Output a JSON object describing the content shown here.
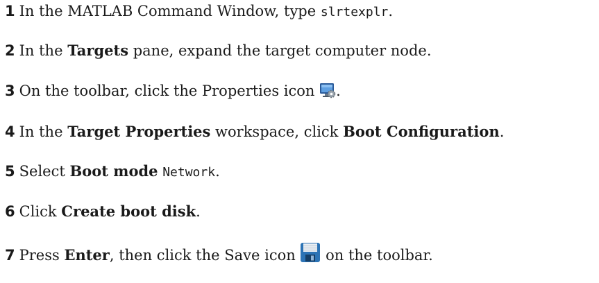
{
  "steps": [
    {
      "number": "1",
      "parts": [
        {
          "t": "text",
          "v": "In the MATLAB Command Window, type "
        },
        {
          "t": "code",
          "v": "slrtexplr"
        },
        {
          "t": "text",
          "v": "."
        }
      ]
    },
    {
      "number": "2",
      "parts": [
        {
          "t": "text",
          "v": "In the "
        },
        {
          "t": "bold",
          "v": "Targets"
        },
        {
          "t": "text",
          "v": " pane, expand the target computer node."
        }
      ]
    },
    {
      "number": "3",
      "parts": [
        {
          "t": "text",
          "v": "On the toolbar, click the Properties icon "
        },
        {
          "t": "icon",
          "v": "properties-icon"
        },
        {
          "t": "text",
          "v": "."
        }
      ]
    },
    {
      "number": "4",
      "parts": [
        {
          "t": "text",
          "v": "In the "
        },
        {
          "t": "bold",
          "v": "Target Properties"
        },
        {
          "t": "text",
          "v": " workspace, click "
        },
        {
          "t": "bold",
          "v": "Boot Configuration"
        },
        {
          "t": "text",
          "v": "."
        }
      ]
    },
    {
      "number": "5",
      "parts": [
        {
          "t": "text",
          "v": "Select "
        },
        {
          "t": "bold",
          "v": "Boot mode"
        },
        {
          "t": "text",
          "v": " "
        },
        {
          "t": "code",
          "v": "Network"
        },
        {
          "t": "text",
          "v": "."
        }
      ]
    },
    {
      "number": "6",
      "parts": [
        {
          "t": "text",
          "v": "Click "
        },
        {
          "t": "bold",
          "v": "Create boot disk"
        },
        {
          "t": "text",
          "v": "."
        }
      ]
    },
    {
      "number": "7",
      "parts": [
        {
          "t": "text",
          "v": "Press "
        },
        {
          "t": "bold",
          "v": "Enter"
        },
        {
          "t": "text",
          "v": ", then click the Save icon "
        },
        {
          "t": "icon",
          "v": "save-icon"
        },
        {
          "t": "text",
          "v": " on the toolbar."
        }
      ]
    }
  ]
}
